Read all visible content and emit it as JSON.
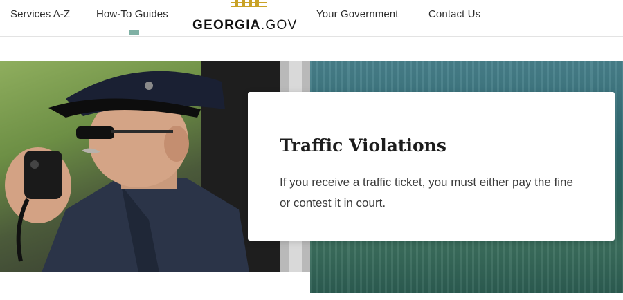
{
  "header": {
    "nav_left": [
      {
        "label": "Services A-Z"
      },
      {
        "label": "How-To Guides"
      }
    ],
    "nav_right": [
      {
        "label": "Your Government"
      },
      {
        "label": "Contact Us"
      }
    ],
    "logo": {
      "strong": "GEORGIA",
      "light": ".GOV"
    },
    "active_item": "How-To Guides"
  },
  "hero": {
    "title": "Traffic Violations",
    "description": "If you receive a traffic ticket, you must either pay the fine or contest it in court.",
    "image": "police-officer-radio-photo"
  },
  "colors": {
    "indicator": "#7fb0a4",
    "logo_gold": "#c9a227",
    "background_teal": "#2f6b72"
  }
}
